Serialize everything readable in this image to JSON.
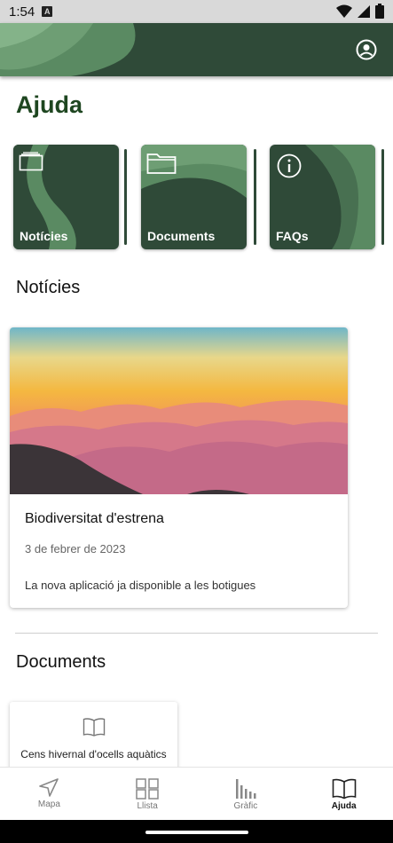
{
  "status_bar": {
    "time": "1:54",
    "notification": "A"
  },
  "page": {
    "title": "Ajuda"
  },
  "categories": [
    {
      "label": "Notícies",
      "icon": "folder-outline-icon"
    },
    {
      "label": "Documents",
      "icon": "folder-icon"
    },
    {
      "label": "FAQs",
      "icon": "info-icon"
    }
  ],
  "news_section": {
    "title": "Notícies",
    "article": {
      "title": "Biodiversitat d'estrena",
      "date": "3 de febrer de 2023",
      "description": "La nova aplicació ja disponible a les botigues"
    }
  },
  "documents_section": {
    "title": "Documents",
    "items": [
      {
        "label": "Cens hivernal d'ocells aquàtics"
      }
    ]
  },
  "bottom_nav": [
    {
      "label": "Mapa",
      "icon": "navigation-icon",
      "active": false
    },
    {
      "label": "Llista",
      "icon": "grid-icon",
      "active": false
    },
    {
      "label": "Gràfic",
      "icon": "bar-chart-icon",
      "active": false
    },
    {
      "label": "Ajuda",
      "icon": "book-icon",
      "active": true
    }
  ],
  "colors": {
    "primary_dark": "#2f4a38",
    "primary_light": "#5a8a62",
    "title_green": "#1e4620"
  }
}
